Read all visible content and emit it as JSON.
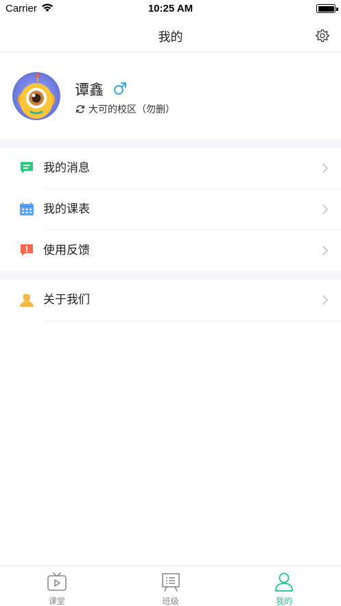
{
  "status_bar": {
    "carrier": "Carrier",
    "time": "10:25 AM"
  },
  "nav": {
    "title": "我的",
    "settings_icon": "gear-icon"
  },
  "profile": {
    "name": "谭鑫",
    "gender_icon": "male-symbol-icon",
    "school": "大可的校区（勿删）",
    "school_icon": "sync-icon"
  },
  "menu": {
    "group1": [
      {
        "label": "我的消息",
        "icon": "message-icon"
      },
      {
        "label": "我的课表",
        "icon": "calendar-icon"
      },
      {
        "label": "使用反馈",
        "icon": "feedback-icon"
      }
    ],
    "group2": [
      {
        "label": "关于我们",
        "icon": "about-user-icon"
      }
    ]
  },
  "tab_bar": {
    "tabs": [
      {
        "label": "课堂",
        "icon": "tv-play-icon"
      },
      {
        "label": "班级",
        "icon": "board-list-icon"
      },
      {
        "label": "我的",
        "icon": "person-icon",
        "active": true
      }
    ]
  },
  "colors": {
    "accent": "#1fc38c",
    "message": "#2ec77f",
    "calendar": "#5aa3f5",
    "feedback": "#f5684e",
    "about": "#f4b942"
  }
}
